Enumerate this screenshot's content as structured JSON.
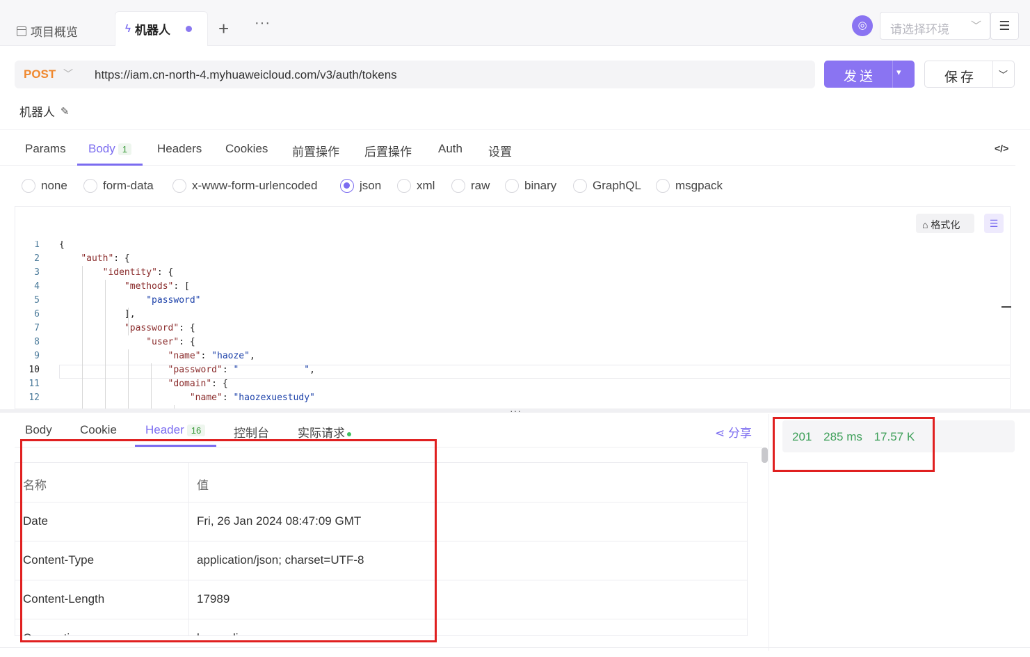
{
  "tabs": {
    "overview_label": "项目概览",
    "active_label": "机器人"
  },
  "env": {
    "placeholder": "请选择环境"
  },
  "request": {
    "method": "POST",
    "url": "https://iam.cn-north-4.myhuaweicloud.com/v3/auth/tokens",
    "send_label": "发送",
    "save_label": "保存",
    "name": "机器人"
  },
  "req_tabs": [
    {
      "label": "Params"
    },
    {
      "label": "Body",
      "badge": "1"
    },
    {
      "label": "Headers"
    },
    {
      "label": "Cookies"
    },
    {
      "label": "前置操作"
    },
    {
      "label": "后置操作"
    },
    {
      "label": "Auth"
    },
    {
      "label": "设置"
    }
  ],
  "body_types": [
    "none",
    "form-data",
    "x-www-form-urlencoded",
    "json",
    "xml",
    "raw",
    "binary",
    "GraphQL",
    "msgpack"
  ],
  "body_type_selected": "json",
  "editor": {
    "format_label": "格式化",
    "current_line": 10,
    "lines": [
      {
        "n": "1",
        "text": "{"
      },
      {
        "n": "2",
        "text": "    \"auth\": {"
      },
      {
        "n": "3",
        "text": "        \"identity\": {"
      },
      {
        "n": "4",
        "text": "            \"methods\": ["
      },
      {
        "n": "5",
        "text": "                \"password\""
      },
      {
        "n": "6",
        "text": "            ],"
      },
      {
        "n": "7",
        "text": "            \"password\": {"
      },
      {
        "n": "8",
        "text": "                \"user\": {"
      },
      {
        "n": "9",
        "text": "                    \"name\": \"haoze\","
      },
      {
        "n": "10",
        "text": "                    \"password\": \"            \","
      },
      {
        "n": "11",
        "text": "                    \"domain\": {"
      },
      {
        "n": "12",
        "text": "                        \"name\": \"haozexuestudy\""
      }
    ]
  },
  "response": {
    "tabs": [
      {
        "label": "Body"
      },
      {
        "label": "Cookie"
      },
      {
        "label": "Header",
        "badge": "16"
      },
      {
        "label": "控制台"
      },
      {
        "label": "实际请求"
      }
    ],
    "share_label": "分享",
    "status": "201",
    "time": "285 ms",
    "size": "17.57 K",
    "header_table": {
      "columns": [
        "名称",
        "值"
      ],
      "rows": [
        [
          "Date",
          "Fri, 26 Jan 2024 08:47:09 GMT"
        ],
        [
          "Content-Type",
          "application/json; charset=UTF-8"
        ],
        [
          "Content-Length",
          "17989"
        ],
        [
          "Connection",
          "keep-alive"
        ]
      ]
    }
  },
  "colors": {
    "accent": "#7b6cf0",
    "method": "#f0882e",
    "status": "#3fa05a",
    "highlight": "#e02020"
  }
}
